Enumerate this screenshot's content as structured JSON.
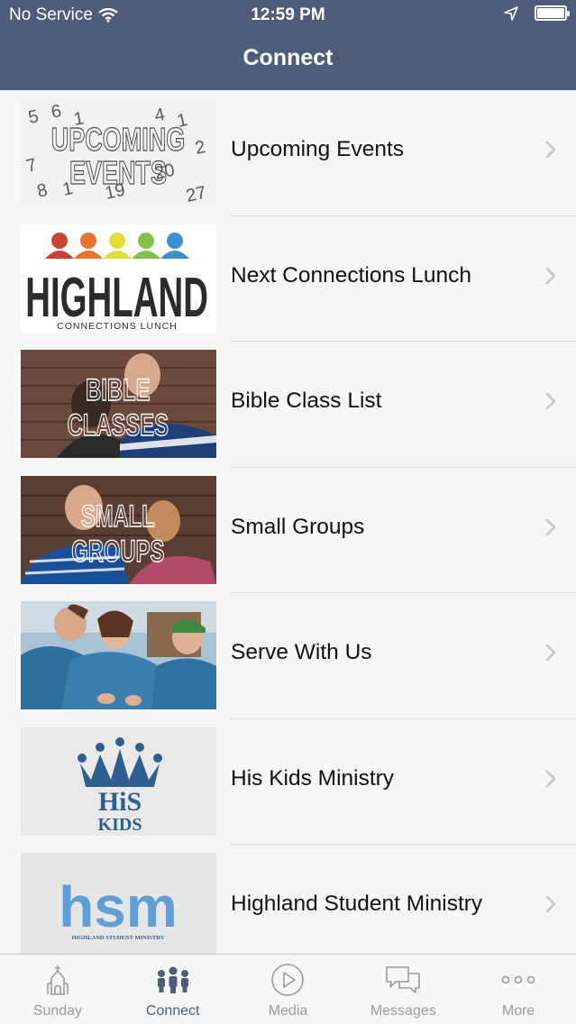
{
  "status_bar": {
    "carrier": "No Service",
    "time": "12:59 PM"
  },
  "nav": {
    "title": "Connect"
  },
  "items": [
    {
      "label": "Upcoming Events",
      "thumb_text": [
        "UPCOMING",
        "EVENTS"
      ]
    },
    {
      "label": "Next Connections Lunch",
      "thumb_text": [
        "HIGHLAND",
        "CONNECTIONS LUNCH"
      ]
    },
    {
      "label": "Bible Class List",
      "thumb_text": [
        "BIBLE",
        "CLASSES"
      ]
    },
    {
      "label": "Small Groups",
      "thumb_text": [
        "SMALL",
        "GROUPS"
      ]
    },
    {
      "label": "Serve With Us",
      "thumb_text": []
    },
    {
      "label": "His Kids Ministry",
      "thumb_text": [
        "HiS",
        "KIDS"
      ]
    },
    {
      "label": "Highland Student Ministry",
      "thumb_text": [
        "hsm",
        "HIGHLAND STUDENT MINISTRY"
      ]
    }
  ],
  "tabs": [
    {
      "label": "Sunday",
      "icon": "church-icon",
      "active": false
    },
    {
      "label": "Connect",
      "icon": "people-icon",
      "active": true
    },
    {
      "label": "Media",
      "icon": "play-icon",
      "active": false
    },
    {
      "label": "Messages",
      "icon": "chat-icon",
      "active": false
    },
    {
      "label": "More",
      "icon": "more-dots-icon",
      "active": false
    }
  ],
  "colors": {
    "nav_bar": "#4d5d79",
    "active_tab": "#4d5d79",
    "inactive_tab": "#9a9a9a",
    "his_kids_blue": "#2f5f8f",
    "hsm_blue": "#5f9fd6"
  }
}
